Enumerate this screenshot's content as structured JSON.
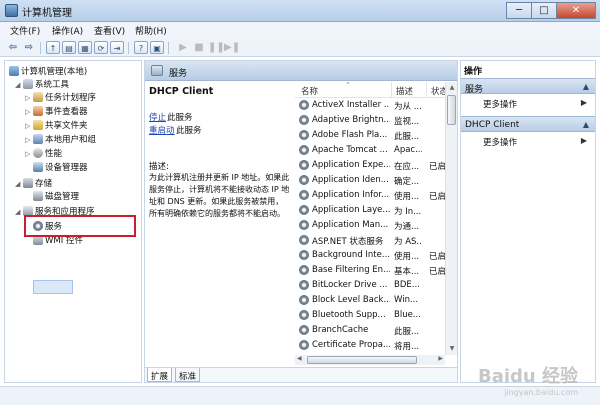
{
  "window": {
    "title": "计算机管理",
    "controls": [
      "─",
      "□",
      "✕"
    ]
  },
  "menu": [
    "文件(F)",
    "操作(A)",
    "查看(V)",
    "帮助(H)"
  ],
  "toolbar": {
    "buttons": [
      "back",
      "forward",
      "up",
      "show-tree",
      "refresh",
      "export",
      "properties",
      "help",
      "console-tree",
      "play",
      "stop",
      "pause",
      "restart"
    ]
  },
  "tree": {
    "root": "计算机管理(本地)",
    "items": [
      {
        "label": "系统工具",
        "level": 1,
        "expander": "◢"
      },
      {
        "label": "任务计划程序",
        "level": 2,
        "expander": "▷"
      },
      {
        "label": "事件查看器",
        "level": 2,
        "expander": "▷"
      },
      {
        "label": "共享文件夹",
        "level": 2,
        "expander": "▷"
      },
      {
        "label": "本地用户和组",
        "level": 2,
        "expander": "▷"
      },
      {
        "label": "性能",
        "level": 2,
        "expander": "▷"
      },
      {
        "label": "设备管理器",
        "level": 2,
        "expander": ""
      },
      {
        "label": "存储",
        "level": 1,
        "expander": "◢"
      },
      {
        "label": "磁盘管理",
        "level": 2,
        "expander": ""
      },
      {
        "label": "服务和应用程序",
        "level": 1,
        "expander": "◢"
      },
      {
        "label": "服务",
        "level": 2,
        "expander": ""
      },
      {
        "label": "WMI 控件",
        "level": 2,
        "expander": ""
      }
    ]
  },
  "main": {
    "header": "服务",
    "detail": {
      "title": "DHCP Client",
      "stop_link": "停止",
      "stop_rest": "此服务",
      "restart_link": "重启动",
      "restart_rest": "此服务",
      "desc_label": "描述:",
      "description": "为此计算机注册并更新 IP 地址。如果此服务停止，计算机将不能接收动态 IP 地址和 DNS 更新。如果此服务被禁用，所有明确依赖它的服务都将不能启动。"
    },
    "columns": [
      "名称",
      "描述",
      "状态"
    ],
    "rows": [
      {
        "name": "ActiveX Installer ...",
        "desc": "为从 ...",
        "status": ""
      },
      {
        "name": "Adaptive Brightn...",
        "desc": "监视...",
        "status": ""
      },
      {
        "name": "Adobe Flash Pla...",
        "desc": "此服...",
        "status": ""
      },
      {
        "name": "Apache Tomcat ...",
        "desc": "Apac...",
        "status": ""
      },
      {
        "name": "Application Expe...",
        "desc": "在应...",
        "status": "已启"
      },
      {
        "name": "Application Iden...",
        "desc": "确定...",
        "status": ""
      },
      {
        "name": "Application Infor...",
        "desc": "使用...",
        "status": "已启"
      },
      {
        "name": "Application Laye...",
        "desc": "为 In...",
        "status": ""
      },
      {
        "name": "Application Man...",
        "desc": "为通...",
        "status": ""
      },
      {
        "name": "ASP.NET 状态服务",
        "desc": "为 AS...",
        "status": ""
      },
      {
        "name": "Background Inte...",
        "desc": "使用...",
        "status": "已启"
      },
      {
        "name": "Base Filtering En...",
        "desc": "基本...",
        "status": "已启"
      },
      {
        "name": "BitLocker Drive ...",
        "desc": "BDE...",
        "status": ""
      },
      {
        "name": "Block Level Back...",
        "desc": "Win...",
        "status": ""
      },
      {
        "name": "Bluetooth Supp...",
        "desc": "Blue...",
        "status": ""
      },
      {
        "name": "BranchCache",
        "desc": "此服...",
        "status": ""
      },
      {
        "name": "Certificate Propa...",
        "desc": "将用...",
        "status": ""
      }
    ],
    "tabs": [
      "扩展",
      "标准"
    ]
  },
  "actions": {
    "title": "操作",
    "sections": [
      {
        "label": "服务",
        "item": "更多操作"
      },
      {
        "label": "DHCP Client",
        "item": "更多操作"
      }
    ]
  },
  "watermark": {
    "main": "Baidu 经验",
    "sub": "jingyan.baidu.com"
  }
}
